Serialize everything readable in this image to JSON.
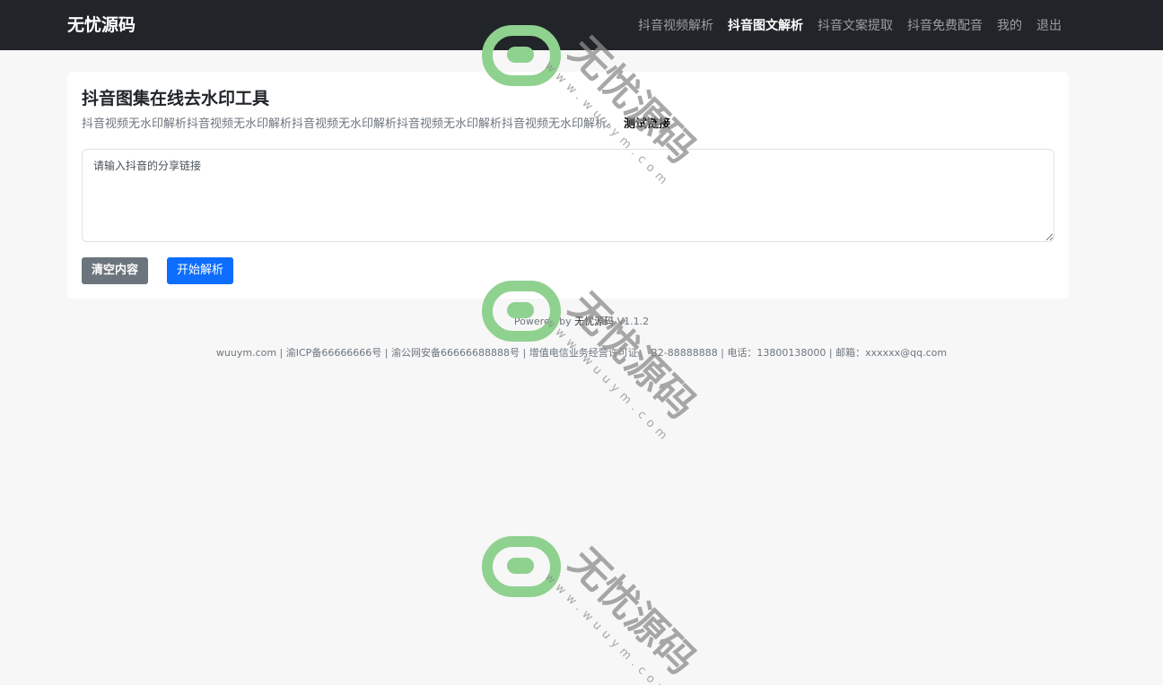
{
  "navbar": {
    "brand": "无忧源码",
    "items": [
      {
        "label": "抖音视频解析",
        "active": false
      },
      {
        "label": "抖音图文解析",
        "active": true
      },
      {
        "label": "抖音文案提取",
        "active": false
      },
      {
        "label": "抖音免费配音",
        "active": false
      },
      {
        "label": "我的",
        "active": false
      },
      {
        "label": "退出",
        "active": false
      }
    ]
  },
  "card": {
    "title": "抖音图集在线去水印工具",
    "description": "抖音视频无水印解析抖音视频无水印解析抖音视频无水印解析抖音视频无水印解析抖音视频无水印解析。",
    "test_link": "测试链接",
    "input_placeholder": "请输入抖音的分享链接",
    "input_value": "",
    "clear_button": "清空内容",
    "parse_button": "开始解析"
  },
  "footer": {
    "powered_prefix": "Powered by",
    "powered_name": "无忧源码",
    "version": "V1.1.2",
    "info": "wuuym.com | 渝ICP备66666666号 | 渝公网安备66666688888号 | 增值电信业务经营许可证： B2-88888888 | 电话：13800138000 | 邮箱：xxxxxx@qq.com"
  },
  "watermark": {
    "text": "无忧源码",
    "url": "www.wuuym.com"
  },
  "colors": {
    "navbar_bg": "#212529",
    "page_bg": "#f7f7f7",
    "primary": "#0d6efd",
    "secondary": "#6c757d",
    "watermark_green": "#8fd18f"
  }
}
